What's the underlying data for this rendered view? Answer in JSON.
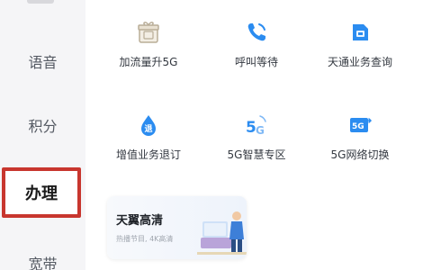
{
  "sidebar": {
    "items": [
      {
        "label": "语音"
      },
      {
        "label": "积分"
      },
      {
        "label": "办理",
        "active": true
      },
      {
        "label": "宽带"
      }
    ]
  },
  "services": [
    {
      "label": "加流量升5G",
      "icon": "gift-box-icon"
    },
    {
      "label": "呼叫等待",
      "icon": "phone-icon"
    },
    {
      "label": "天通业务查询",
      "icon": "sim-card-icon"
    },
    {
      "label": "增值业务退订",
      "icon": "drop-icon"
    },
    {
      "label": "5G智慧专区",
      "icon": "5g-icon"
    },
    {
      "label": "5G网络切换",
      "icon": "5g-switch-icon"
    }
  ],
  "promo_card": {
    "title": "天翼高清",
    "subtitle": "热播节目, 4K高清"
  },
  "colors": {
    "accent": "#2b8cf0",
    "highlight_border": "#c8362e",
    "sidebar_bg": "#f5f5f7"
  }
}
